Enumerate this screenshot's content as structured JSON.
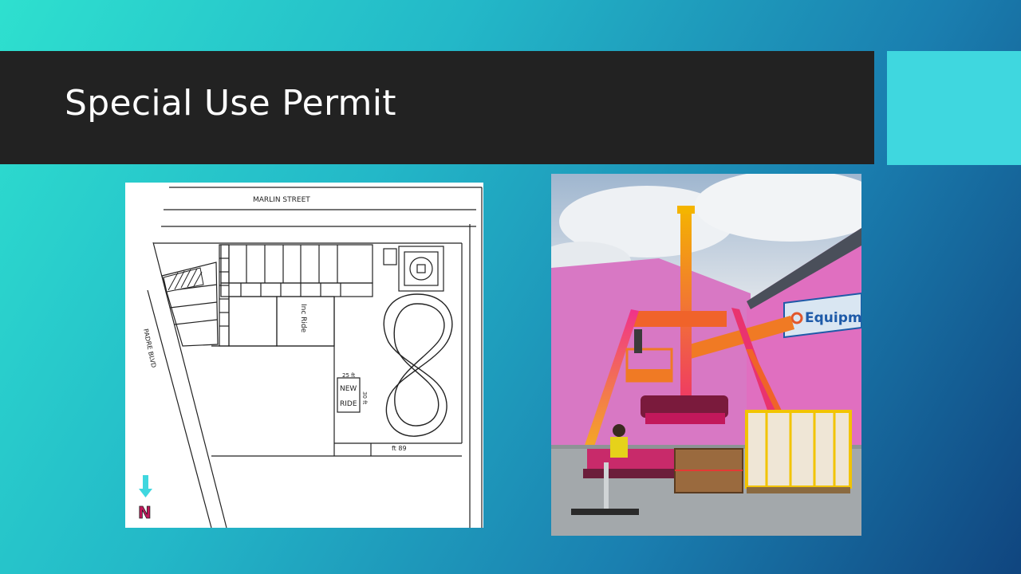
{
  "slide": {
    "title": "Special Use Permit"
  },
  "site_map": {
    "street_top": "MARLIN STREET",
    "street_left": "PADRE BLVD",
    "existing_ride_label": "Inc Ride",
    "new_ride_label_line1": "NEW",
    "new_ride_label_line2": "RIDE",
    "dim_width": "25 ft",
    "dim_depth": "30 ft",
    "dim_bottom": "ft 89",
    "north_label": "N"
  },
  "photo": {
    "banner_text": "Equipme"
  },
  "colors": {
    "title_bar": "#222222",
    "accent": "#3fd7df",
    "north_arrow": "#3fd7df",
    "north_letter": "#c2185b"
  }
}
